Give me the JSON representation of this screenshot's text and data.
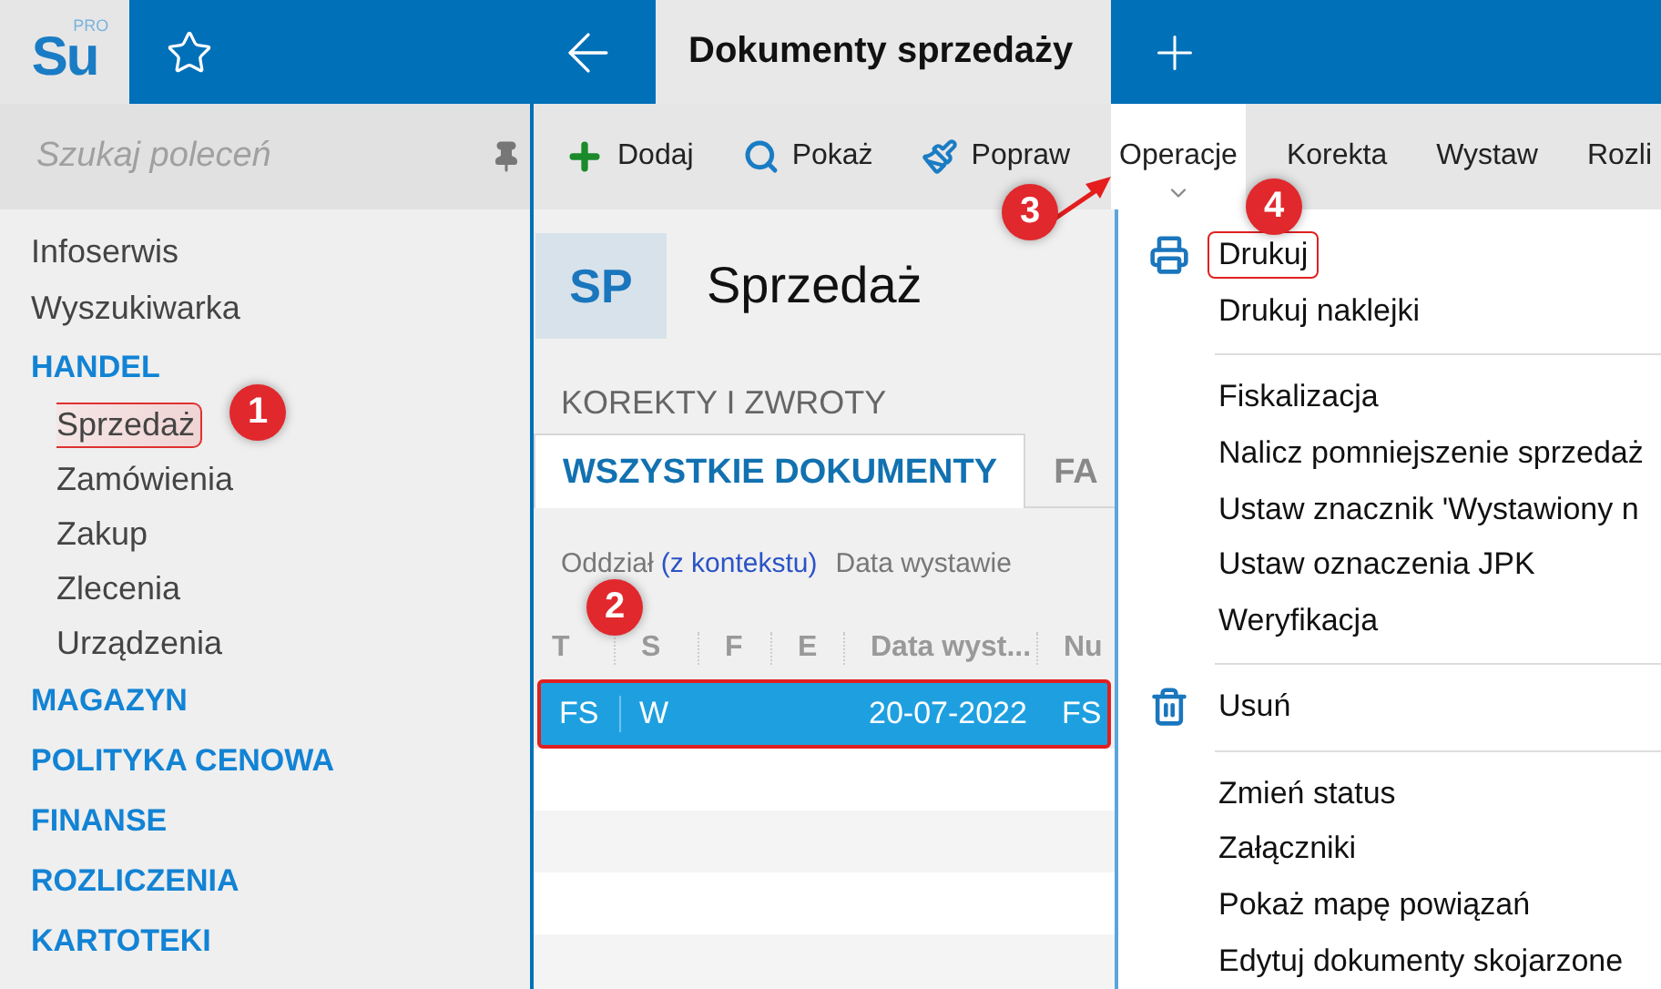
{
  "logo": {
    "text": "Su",
    "badge": "PRO"
  },
  "tab": {
    "label": "Dokumenty sprzedaży"
  },
  "search": {
    "placeholder": "Szukaj poleceń"
  },
  "sidebar": {
    "items": [
      {
        "label": "Infoserwis",
        "kind": "link",
        "selected": false
      },
      {
        "label": "Wyszukiwarka",
        "kind": "link",
        "selected": false
      },
      {
        "label": "HANDEL",
        "kind": "section",
        "selected": false,
        "children": [
          {
            "label": "Sprzedaż",
            "selected": true
          },
          {
            "label": "Zamówienia",
            "selected": false
          },
          {
            "label": "Zakup",
            "selected": false
          },
          {
            "label": "Zlecenia",
            "selected": false
          },
          {
            "label": "Urządzenia",
            "selected": false
          }
        ]
      },
      {
        "label": "MAGAZYN",
        "kind": "section",
        "selected": false
      },
      {
        "label": "POLITYKA CENOWA",
        "kind": "section",
        "selected": false
      },
      {
        "label": "FINANSE",
        "kind": "section",
        "selected": false
      },
      {
        "label": "ROZLICZENIA",
        "kind": "section",
        "selected": false
      },
      {
        "label": "KARTOTEKI",
        "kind": "section",
        "selected": false
      }
    ]
  },
  "toolbar": [
    {
      "label": "Dodaj",
      "selected": false
    },
    {
      "label": "Pokaż",
      "selected": false
    },
    {
      "label": "Popraw",
      "selected": false
    },
    {
      "label": "Operacje",
      "selected": true
    },
    {
      "label": "Korekta",
      "selected": false
    },
    {
      "label": "Wystaw",
      "selected": false
    },
    {
      "label": "Rozli",
      "selected": false
    }
  ],
  "header": {
    "code": "SP",
    "title": "Sprzedaż"
  },
  "section_title": "KOREKTY I ZWROTY",
  "doc_tabs": [
    {
      "label": "WSZYSTKIE DOKUMENTY",
      "selected": true
    },
    {
      "label": "FA",
      "selected": false
    }
  ],
  "filters": {
    "label": "Oddział",
    "link": "(z kontekstu)",
    "next": "Data wystawie"
  },
  "table": {
    "columns": [
      "T",
      "S",
      "F",
      "E",
      "Data wyst...",
      "Nu"
    ],
    "rows": [
      {
        "cells": [
          "FS",
          "W",
          "",
          "",
          "20-07-2022",
          "FS"
        ],
        "selected": true
      }
    ]
  },
  "menu": [
    {
      "kind": "item",
      "label": "Drukuj",
      "highlighted": true
    },
    {
      "kind": "item",
      "label": "Drukuj naklejki",
      "highlighted": false
    },
    {
      "kind": "separator"
    },
    {
      "kind": "item",
      "label": "Fiskalizacja",
      "highlighted": false
    },
    {
      "kind": "item",
      "label": "Nalicz pomniejszenie sprzedaż",
      "highlighted": false
    },
    {
      "kind": "item",
      "label": "Ustaw znacznik 'Wystawiony n",
      "highlighted": false
    },
    {
      "kind": "item",
      "label": "Ustaw oznaczenia JPK",
      "highlighted": false
    },
    {
      "kind": "item",
      "label": "Weryfikacja",
      "highlighted": false
    },
    {
      "kind": "separator"
    },
    {
      "kind": "item",
      "label": "Usuń",
      "highlighted": false
    },
    {
      "kind": "separator"
    },
    {
      "kind": "item",
      "label": "Zmień status",
      "highlighted": false
    },
    {
      "kind": "item",
      "label": "Załączniki",
      "highlighted": false
    },
    {
      "kind": "item",
      "label": "Pokaż mapę powiązań",
      "highlighted": false
    },
    {
      "kind": "item",
      "label": "Edytuj dokumenty skojarzone",
      "highlighted": false
    }
  ],
  "annotations": [
    {
      "label": "1"
    },
    {
      "label": "2"
    },
    {
      "label": "3"
    },
    {
      "label": "4"
    }
  ]
}
